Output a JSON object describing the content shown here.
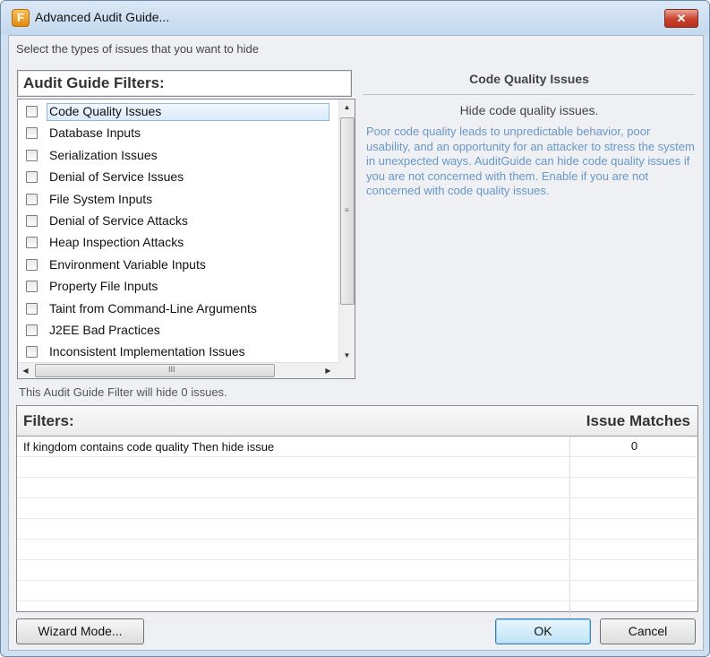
{
  "window": {
    "title": "Advanced Audit Guide...",
    "close_glyph": "✕",
    "app_icon_glyph": "F"
  },
  "instruction": "Select the types of issues that you want to hide",
  "audit_filters": {
    "header": "Audit Guide Filters:",
    "items": [
      {
        "label": "Code Quality Issues",
        "checked": false,
        "selected": true
      },
      {
        "label": "Database Inputs",
        "checked": false
      },
      {
        "label": "Serialization Issues",
        "checked": false
      },
      {
        "label": "Denial of Service Issues",
        "checked": false
      },
      {
        "label": "File System Inputs",
        "checked": false
      },
      {
        "label": "Denial of Service Attacks",
        "checked": false
      },
      {
        "label": "Heap Inspection Attacks",
        "checked": false
      },
      {
        "label": "Environment Variable Inputs",
        "checked": false
      },
      {
        "label": "Property File Inputs",
        "checked": false
      },
      {
        "label": "Taint from Command-Line Arguments",
        "checked": false
      },
      {
        "label": "J2EE Bad Practices",
        "checked": false
      },
      {
        "label": "Inconsistent Implementation Issues",
        "checked": false
      }
    ],
    "scroll_glyphs": {
      "up": "▲",
      "down": "▼",
      "left": "◀",
      "right": "▶",
      "grip_v": "≡",
      "grip_h": "III"
    }
  },
  "detail": {
    "title": "Code Quality Issues",
    "subtitle": "Hide code quality issues.",
    "description": "Poor code quality leads to unpredictable behavior, poor usability, and an opportunity for an attacker to stress the system in unexpected ways. AuditGuide can hide code quality issues if you are not concerned with them. Enable if you are not concerned with code quality issues."
  },
  "hide_count_text": "This Audit Guide Filter will hide 0 issues.",
  "filters_table": {
    "col_filter": "Filters:",
    "col_matches": "Issue Matches",
    "rows": [
      {
        "filter": "If kingdom contains code quality Then hide issue",
        "matches": "0"
      }
    ]
  },
  "buttons": {
    "wizard": "Wizard Mode...",
    "ok": "OK",
    "cancel": "Cancel"
  }
}
